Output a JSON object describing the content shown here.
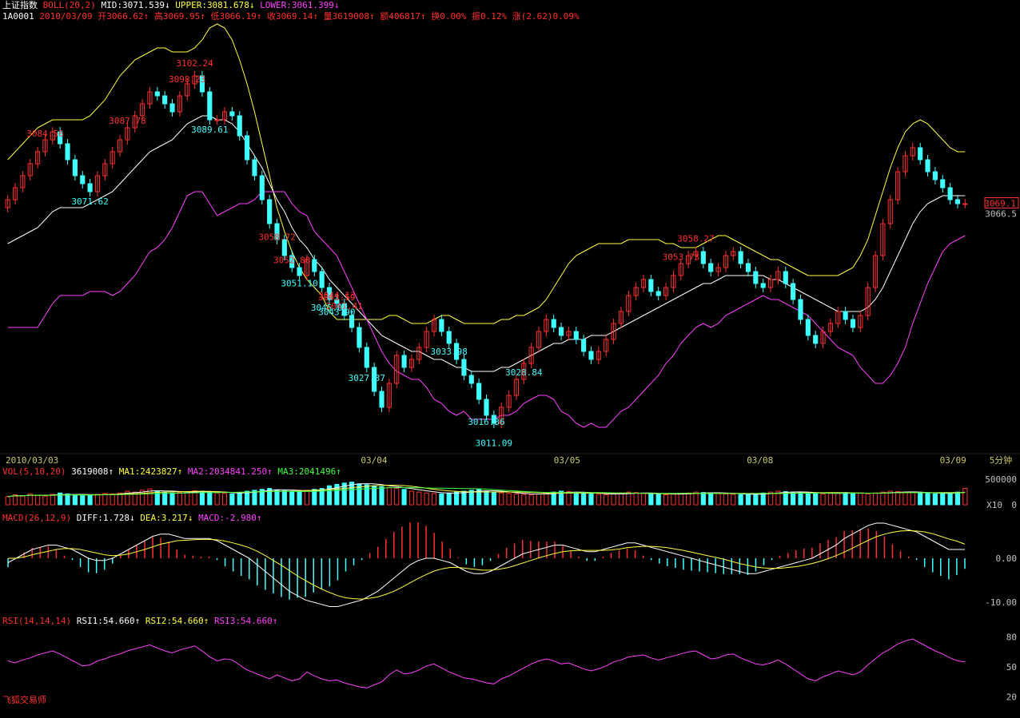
{
  "header": {
    "line1": {
      "name": "上证指数",
      "indicator": "BOLL(20,2)",
      "mid": "MID:3071.539↓",
      "upper": "UPPER:3081.678↓",
      "lower": "LOWER:3061.399↓"
    },
    "line2": {
      "code": "1A0001",
      "date": "2010/03/09",
      "open": "开3066.62↑",
      "high": "高3069.95↑",
      "low": "低3066.19↑",
      "close": "收3069.14↑",
      "volume": "量3619008↑",
      "amount": "额406817↑",
      "turnover": "换0.00%",
      "amplitude": "振0.12%",
      "change": "涨(2.62)0.09%"
    }
  },
  "vol_header": {
    "name": "VOL(5,10,20)",
    "value": "3619008↑",
    "ma1": "MA1:2423827↑",
    "ma2": "MA2:2034841.250↑",
    "ma3": "MA3:2041496↑"
  },
  "macd_header": {
    "name": "MACD(26,12,9)",
    "diff": "DIFF:1.728↓",
    "dea": "DEA:3.217↓",
    "macd": "MACD:-2.980↑"
  },
  "rsi_header": {
    "name": "RSI(14,14,14)",
    "rsi1": "RSI1:54.660↑",
    "rsi2": "RSI2:54.660↑",
    "rsi3": "RSI3:54.660↑"
  },
  "date_axis": [
    "2010/03/03",
    "03/04",
    "03/05",
    "03/08",
    "03/09"
  ],
  "period_label": "5分钟",
  "price_axis": {
    "current": "3069.1",
    "mid": "3066.5"
  },
  "vol_axis": {
    "top": "500000",
    "unit": "X10",
    "zero": "0"
  },
  "macd_axis": {
    "zero": "0.00",
    "neg": "-10.00"
  },
  "rsi_axis": [
    "80",
    "50",
    "20"
  ],
  "price_annotations": [
    {
      "text": "3087.78",
      "kind": "high"
    },
    {
      "text": "3098.23",
      "kind": "high"
    },
    {
      "text": "3102.24",
      "kind": "high"
    },
    {
      "text": "3089.61",
      "kind": "low"
    },
    {
      "text": "3071.62",
      "kind": "low"
    },
    {
      "text": "3041.41",
      "kind": "high"
    },
    {
      "text": "3016.36",
      "kind": "low"
    },
    {
      "text": "3044.13",
      "kind": "high"
    },
    {
      "text": "3011.09",
      "kind": "low"
    },
    {
      "text": "3027.37",
      "kind": "low"
    },
    {
      "text": "3052.88",
      "kind": "high"
    },
    {
      "text": "3043.90",
      "kind": "low"
    },
    {
      "text": "3058.27",
      "kind": "high"
    },
    {
      "text": "3058.72",
      "kind": "high"
    },
    {
      "text": "3051.10",
      "kind": "low"
    },
    {
      "text": "3053.73",
      "kind": "high"
    },
    {
      "text": "3045.02",
      "kind": "low"
    },
    {
      "text": "3043.59",
      "kind": "high"
    },
    {
      "text": "3028.84",
      "kind": "low"
    },
    {
      "text": "3033.98",
      "kind": "low"
    },
    {
      "text": "3084.56",
      "kind": "high"
    }
  ],
  "brand": "飞狐交易师",
  "colors": {
    "up": "#ff3030",
    "down": "#40ffff",
    "mid": "#ffffff",
    "upper": "#ffff40",
    "lower": "#ff40ff",
    "ma3": "#40ff40"
  },
  "chart_data": {
    "type": "candlestick",
    "title": "上证指数",
    "period": "5分钟",
    "price_range": [
      3008,
      3114
    ],
    "price_closes": [
      3070,
      3073,
      3076,
      3079,
      3082,
      3085,
      3087,
      3084,
      3080,
      3076,
      3074,
      3072,
      3076,
      3079,
      3082,
      3085,
      3088,
      3091,
      3094,
      3097,
      3096,
      3094,
      3092,
      3096,
      3099,
      3101,
      3097,
      3090,
      3090,
      3092,
      3091,
      3086,
      3080,
      3076,
      3070,
      3064,
      3060,
      3056,
      3053,
      3051,
      3055,
      3052,
      3048,
      3045,
      3044,
      3041,
      3038,
      3033,
      3028,
      3022,
      3018,
      3024,
      3031,
      3028,
      3030,
      3033,
      3037,
      3040,
      3037,
      3034,
      3030,
      3026,
      3024,
      3020,
      3016,
      3014,
      3018,
      3021,
      3025,
      3029,
      3033,
      3037,
      3040,
      3038,
      3036,
      3037,
      3035,
      3032,
      3030,
      3032,
      3035,
      3039,
      3042,
      3046,
      3048,
      3050,
      3047,
      3046,
      3048,
      3051,
      3054,
      3056,
      3057,
      3054,
      3052,
      3053,
      3056,
      3057,
      3054,
      3052,
      3049,
      3048,
      3050,
      3052,
      3049,
      3045,
      3040,
      3036,
      3034,
      3037,
      3039,
      3042,
      3040,
      3038,
      3041,
      3048,
      3056,
      3064,
      3070,
      3077,
      3081,
      3083,
      3080,
      3077,
      3075,
      3073,
      3070,
      3069,
      3069
    ],
    "mid": [
      3059,
      3060,
      3061,
      3062,
      3063,
      3065,
      3067,
      3068,
      3068,
      3068,
      3068,
      3069,
      3070,
      3071,
      3072,
      3074,
      3076,
      3078,
      3080,
      3082,
      3083,
      3084,
      3085,
      3087,
      3089,
      3090,
      3091,
      3091,
      3090,
      3090,
      3089,
      3087,
      3084,
      3081,
      3078,
      3074,
      3070,
      3067,
      3063,
      3060,
      3058,
      3055,
      3053,
      3050,
      3048,
      3046,
      3044,
      3042,
      3040,
      3038,
      3036,
      3035,
      3034,
      3033,
      3032,
      3032,
      3031,
      3030,
      3030,
      3029,
      3028,
      3028,
      3027,
      3027,
      3027,
      3027,
      3028,
      3028,
      3029,
      3030,
      3031,
      3032,
      3033,
      3034,
      3034,
      3035,
      3035,
      3035,
      3036,
      3036,
      3036,
      3037,
      3038,
      3039,
      3040,
      3041,
      3042,
      3043,
      3044,
      3045,
      3046,
      3047,
      3048,
      3049,
      3049,
      3050,
      3051,
      3051,
      3051,
      3051,
      3051,
      3051,
      3050,
      3050,
      3049,
      3048,
      3047,
      3046,
      3045,
      3044,
      3043,
      3042,
      3042,
      3042,
      3042,
      3043,
      3045,
      3048,
      3052,
      3056,
      3060,
      3064,
      3067,
      3069,
      3070,
      3071,
      3071,
      3071,
      3071
    ],
    "upper": [
      3080,
      3082,
      3084,
      3086,
      3088,
      3089,
      3090,
      3090,
      3090,
      3090,
      3090,
      3091,
      3093,
      3095,
      3098,
      3101,
      3103,
      3105,
      3106,
      3107,
      3108,
      3108,
      3107,
      3107,
      3107,
      3108,
      3110,
      3113,
      3114,
      3113,
      3110,
      3105,
      3099,
      3092,
      3084,
      3076,
      3068,
      3062,
      3057,
      3053,
      3050,
      3048,
      3046,
      3042,
      3040,
      3040,
      3040,
      3040,
      3040,
      3040,
      3040,
      3041,
      3041,
      3040,
      3039,
      3039,
      3039,
      3040,
      3041,
      3041,
      3040,
      3039,
      3039,
      3039,
      3039,
      3039,
      3040,
      3040,
      3041,
      3041,
      3042,
      3043,
      3045,
      3048,
      3051,
      3054,
      3056,
      3057,
      3058,
      3059,
      3059,
      3059,
      3059,
      3060,
      3060,
      3060,
      3060,
      3060,
      3059,
      3059,
      3058,
      3058,
      3058,
      3059,
      3060,
      3061,
      3061,
      3060,
      3059,
      3058,
      3057,
      3056,
      3055,
      3055,
      3054,
      3053,
      3052,
      3051,
      3051,
      3051,
      3051,
      3051,
      3052,
      3053,
      3056,
      3060,
      3066,
      3072,
      3078,
      3083,
      3087,
      3089,
      3090,
      3089,
      3087,
      3085,
      3083,
      3082,
      3082
    ],
    "lower": [
      3038,
      3038,
      3038,
      3038,
      3038,
      3041,
      3044,
      3046,
      3046,
      3046,
      3046,
      3047,
      3047,
      3047,
      3046,
      3047,
      3049,
      3051,
      3054,
      3057,
      3058,
      3060,
      3063,
      3067,
      3071,
      3072,
      3072,
      3069,
      3066,
      3067,
      3068,
      3069,
      3069,
      3070,
      3072,
      3072,
      3072,
      3072,
      3069,
      3067,
      3066,
      3062,
      3060,
      3058,
      3056,
      3052,
      3048,
      3044,
      3040,
      3036,
      3032,
      3029,
      3027,
      3026,
      3025,
      3025,
      3023,
      3020,
      3019,
      3017,
      3016,
      3017,
      3015,
      3015,
      3015,
      3015,
      3016,
      3016,
      3017,
      3019,
      3020,
      3021,
      3021,
      3020,
      3017,
      3016,
      3014,
      3013,
      3014,
      3013,
      3013,
      3015,
      3017,
      3018,
      3020,
      3022,
      3024,
      3026,
      3029,
      3031,
      3034,
      3036,
      3038,
      3039,
      3038,
      3039,
      3041,
      3042,
      3043,
      3044,
      3045,
      3046,
      3045,
      3045,
      3044,
      3043,
      3042,
      3041,
      3039,
      3037,
      3035,
      3033,
      3032,
      3031,
      3028,
      3026,
      3024,
      3024,
      3026,
      3029,
      3033,
      3039,
      3044,
      3049,
      3053,
      3057,
      3059,
      3060,
      3061
    ],
    "volume_range": [
      0,
      600000
    ],
    "volume": [
      180000,
      220000,
      200000,
      240000,
      210000,
      190000,
      230000,
      260000,
      240000,
      220000,
      200000,
      210000,
      230000,
      250000,
      240000,
      260000,
      300000,
      280000,
      320000,
      350000,
      300000,
      280000,
      260000,
      270000,
      290000,
      310000,
      300000,
      280000,
      260000,
      250000,
      240000,
      270000,
      300000,
      320000,
      340000,
      360000,
      330000,
      310000,
      290000,
      300000,
      320000,
      340000,
      360000,
      420000,
      450000,
      480000,
      500000,
      460000,
      440000,
      420000,
      400000,
      380000,
      360000,
      340000,
      300000,
      280000,
      260000,
      250000,
      240000,
      260000,
      280000,
      300000,
      320000,
      340000,
      300000,
      280000,
      260000,
      250000,
      240000,
      230000,
      220000,
      240000,
      260000,
      280000,
      300000,
      290000,
      270000,
      250000,
      240000,
      230000,
      220000,
      240000,
      260000,
      280000,
      270000,
      250000,
      240000,
      230000,
      220000,
      240000,
      250000,
      260000,
      280000,
      270000,
      260000,
      250000,
      240000,
      230000,
      220000,
      230000,
      240000,
      260000,
      280000,
      300000,
      290000,
      280000,
      270000,
      260000,
      250000,
      240000,
      250000,
      260000,
      270000,
      260000,
      250000,
      240000,
      260000,
      280000,
      300000,
      290000,
      280000,
      270000,
      260000,
      250000,
      240000,
      250000,
      260000,
      280000,
      361900
    ],
    "macd_range": [
      -12,
      8
    ],
    "diff": [
      -1,
      0,
      1,
      2,
      2.5,
      3,
      3,
      2.5,
      2,
      1,
      0,
      -0.5,
      -0.5,
      0,
      1,
      2,
      3,
      4,
      5,
      5.5,
      5.5,
      5,
      4.5,
      4.5,
      4.5,
      4.5,
      4,
      3,
      2,
      1,
      0,
      -1.5,
      -3,
      -4.5,
      -6,
      -7.5,
      -8.5,
      -9.5,
      -10,
      -10.5,
      -11,
      -11,
      -10.5,
      -10,
      -9.5,
      -8.5,
      -7.5,
      -6,
      -4.5,
      -3,
      -1.5,
      -0.5,
      0,
      0,
      -0.5,
      -1,
      -2,
      -3,
      -3.5,
      -3.5,
      -3,
      -2,
      -1,
      0,
      1,
      1.5,
      2,
      2.5,
      3,
      3,
      2.5,
      2,
      1.5,
      1.5,
      2,
      2.5,
      3,
      3.5,
      3.5,
      3,
      2.5,
      2,
      1.5,
      1,
      0.5,
      0,
      -0.5,
      -1,
      -1.5,
      -2,
      -2.5,
      -3,
      -3.5,
      -3.5,
      -3,
      -2.5,
      -2,
      -1.5,
      -1,
      -0.5,
      0,
      1,
      2,
      3,
      4.5,
      5.5,
      6.5,
      7.5,
      8,
      8,
      7.5,
      7,
      6.5,
      6,
      5,
      4,
      3,
      2,
      2,
      2
    ],
    "dea": [
      0,
      0,
      0.3,
      0.8,
      1.2,
      1.6,
      2,
      2.2,
      2.2,
      2,
      1.6,
      1.2,
      0.8,
      0.6,
      0.7,
      1,
      1.5,
      2,
      2.6,
      3.2,
      3.6,
      4,
      4.1,
      4.2,
      4.3,
      4.3,
      4.2,
      3.9,
      3.5,
      3,
      2.4,
      1.6,
      0.6,
      -0.5,
      -1.6,
      -2.8,
      -4,
      -5.1,
      -6.1,
      -7,
      -7.8,
      -8.5,
      -9,
      -9.2,
      -9.3,
      -9.1,
      -8.8,
      -8.2,
      -7.5,
      -6.6,
      -5.6,
      -4.6,
      -3.7,
      -2.9,
      -2.4,
      -2.1,
      -2.1,
      -2.3,
      -2.5,
      -2.7,
      -2.7,
      -2.5,
      -2.2,
      -1.7,
      -1.1,
      -0.5,
      0.1,
      0.6,
      1.1,
      1.5,
      1.7,
      1.8,
      1.8,
      1.8,
      1.8,
      1.9,
      2.1,
      2.4,
      2.6,
      2.7,
      2.7,
      2.6,
      2.4,
      2.1,
      1.8,
      1.4,
      1,
      0.6,
      0.2,
      -0.2,
      -0.7,
      -1.2,
      -1.6,
      -2,
      -2.2,
      -2.3,
      -2.3,
      -2.1,
      -1.9,
      -1.6,
      -1.2,
      -0.7,
      -0.1,
      0.6,
      1.4,
      2.3,
      3.2,
      4.1,
      4.9,
      5.5,
      5.9,
      6.2,
      6.3,
      6.2,
      6,
      5.6,
      5,
      4.4,
      3.9,
      3.2
    ],
    "rsi_range": [
      10,
      90
    ],
    "rsi": [
      56,
      54,
      57,
      59,
      62,
      64,
      66,
      63,
      59,
      55,
      51,
      52,
      56,
      58,
      61,
      63,
      66,
      68,
      70,
      72,
      69,
      66,
      64,
      67,
      69,
      71,
      66,
      60,
      56,
      58,
      57,
      52,
      47,
      44,
      41,
      38,
      42,
      39,
      36,
      38,
      45,
      41,
      38,
      36,
      37,
      34,
      32,
      30,
      29,
      32,
      35,
      42,
      47,
      43,
      44,
      47,
      51,
      53,
      49,
      45,
      42,
      39,
      38,
      36,
      34,
      33,
      38,
      41,
      45,
      49,
      53,
      56,
      58,
      56,
      53,
      54,
      51,
      48,
      46,
      48,
      51,
      55,
      57,
      60,
      61,
      62,
      59,
      57,
      59,
      61,
      63,
      65,
      66,
      62,
      58,
      59,
      62,
      63,
      59,
      56,
      53,
      52,
      54,
      57,
      53,
      48,
      43,
      38,
      36,
      40,
      43,
      46,
      44,
      42,
      45,
      52,
      58,
      64,
      68,
      73,
      76,
      78,
      74,
      70,
      66,
      63,
      59,
      56,
      55
    ]
  }
}
